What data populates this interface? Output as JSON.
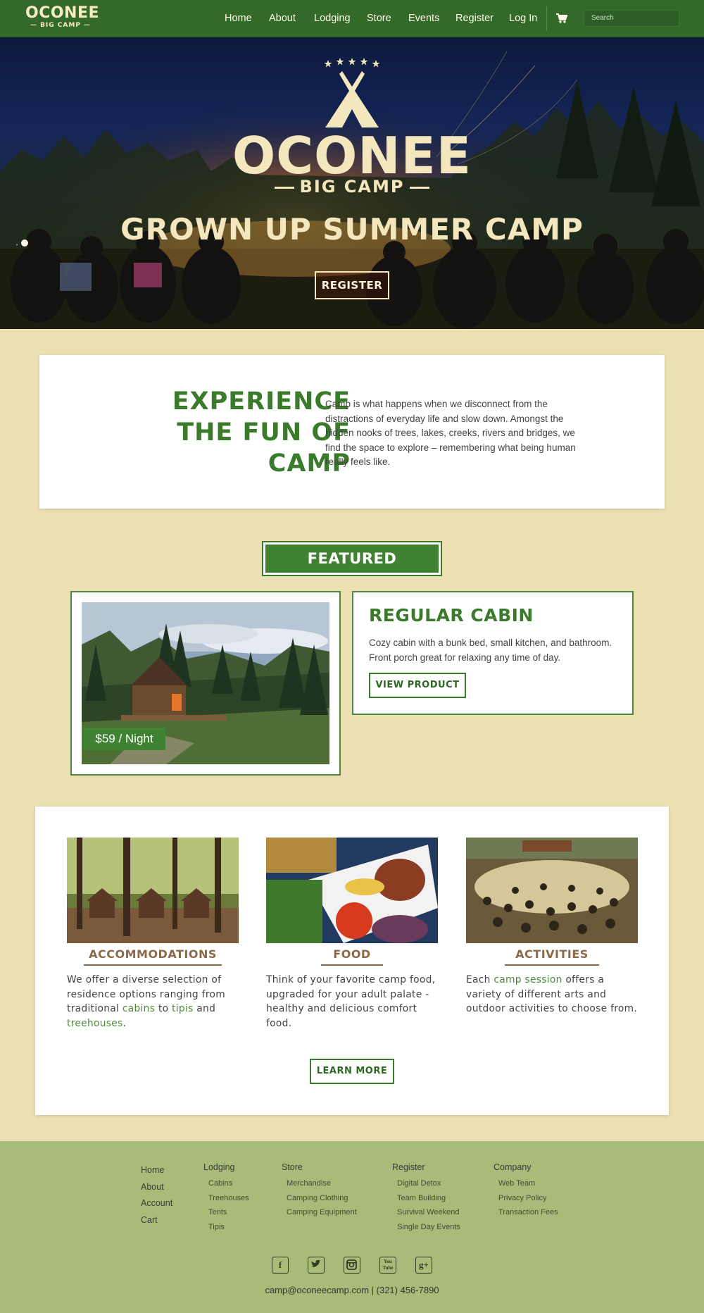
{
  "nav": {
    "logo_line1": "OCONEE",
    "logo_line2": "— BIG CAMP —",
    "links": [
      "Home",
      "About",
      "Lodging",
      "Store",
      "Events",
      "Register",
      "Log In"
    ],
    "cart_icon": "cart-icon",
    "search_placeholder": "Search"
  },
  "hero": {
    "logo_line1": "OCONEE",
    "logo_line2": "BIG CAMP",
    "tagline": "GROWN UP SUMMER CAMP",
    "cta": "REGISTER"
  },
  "experience": {
    "title": "EXPERIENCE THE FUN OF CAMP",
    "body": "Camp is what happens when we disconnect from the distractions of everyday life and slow down. Amongst the hidden nooks of trees, lakes, creeks, rivers and bridges, we find the space to explore – remembering what being human really feels like."
  },
  "featured": {
    "badge": "FEATURED",
    "price": "$59 / Night",
    "title": "REGULAR CABIN",
    "description": "Cozy cabin with a bunk bed, small kitchen, and bathroom. Front porch great for relaxing any time of day.",
    "button": "VIEW PRODUCT"
  },
  "columns": [
    {
      "title": "ACCOMMODATIONS",
      "text_a": "We offer a diverse selection of residence options ranging from traditional ",
      "link1": "cabins",
      "text_b": " to ",
      "link2": "tipis",
      "text_c": " and ",
      "link3": "treehouses",
      "text_d": "."
    },
    {
      "title": "FOOD",
      "text": "Think of your favorite camp food, upgraded for your adult palate - healthy and delicious comfort food."
    },
    {
      "title": "ACTIVITIES",
      "text_a": "Each ",
      "link1": "camp session",
      "text_b": " offers a variety of different arts and outdoor activities to choose from."
    }
  ],
  "learn_more": "LEARN MORE",
  "footer": {
    "main_links": [
      "Home",
      "About",
      "Account",
      "Cart"
    ],
    "lodging": {
      "head": "Lodging",
      "items": [
        "Cabins",
        "Treehouses",
        "Tents",
        "Tipis"
      ]
    },
    "store": {
      "head": "Store",
      "items": [
        "Merchandise",
        "Camping Clothing",
        "Camping Equipment"
      ]
    },
    "register": {
      "head": "Register",
      "items": [
        "Digital Detox",
        "Team Building",
        "Survival Weekend",
        "Single Day Events"
      ]
    },
    "company": {
      "head": "Company",
      "items": [
        "Web Team",
        "Privacy Policy",
        "Transaction Fees"
      ]
    },
    "social": [
      "f",
      "t",
      "i",
      "You Tube",
      "g+"
    ],
    "contact": "camp@oconeecamp.com | (321) 456-7890"
  },
  "colors": {
    "nav_green": "#336a29",
    "accent_green": "#3f8231",
    "tan": "#ecdfb3",
    "brown": "#8a6a48",
    "footer_green": "#a8bc7a"
  }
}
